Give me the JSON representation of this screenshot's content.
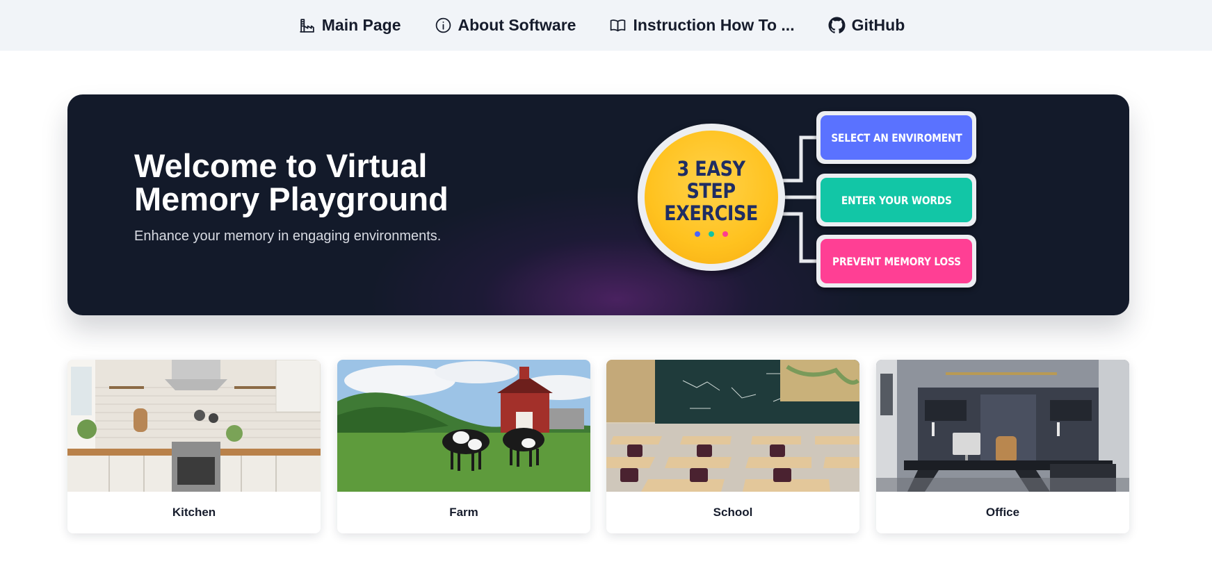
{
  "nav": {
    "items": [
      {
        "label": "Main Page",
        "icon": "factory-icon"
      },
      {
        "label": "About Software",
        "icon": "info-icon"
      },
      {
        "label": "Instruction How To ...",
        "icon": "book-icon"
      },
      {
        "label": "GitHub",
        "icon": "github-icon"
      }
    ]
  },
  "hero": {
    "title": "Welcome to Virtual Memory Playground",
    "subtitle": "Enhance your memory in engaging environments.",
    "badge": {
      "line1": "3 EASY",
      "line2": "STEP",
      "line3": "EXERCISE",
      "dot_colors": [
        "#4a64ff",
        "#10c3a3",
        "#ff3c8e"
      ]
    },
    "steps": [
      {
        "label": "SELECT AN ENVIROMENT",
        "color": "#5a72ff"
      },
      {
        "label": "ENTER YOUR WORDS",
        "color": "#12c6a6"
      },
      {
        "label": "PREVENT MEMORY LOSS",
        "color": "#ff3f94"
      }
    ]
  },
  "environments": [
    {
      "label": "Kitchen",
      "image": "kitchen-image"
    },
    {
      "label": "Farm",
      "image": "farm-image"
    },
    {
      "label": "School",
      "image": "school-image"
    },
    {
      "label": "Office",
      "image": "office-image"
    }
  ]
}
